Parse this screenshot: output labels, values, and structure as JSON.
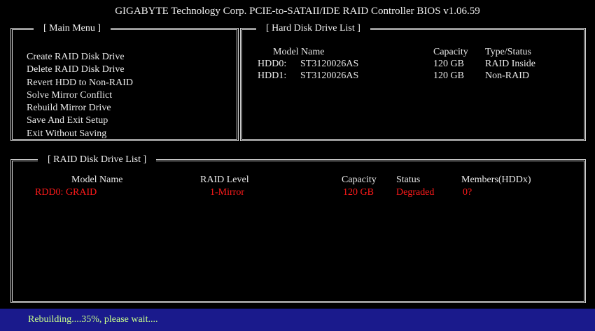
{
  "title": "GIGABYTE Technology Corp. PCIE-to-SATAII/IDE RAID Controller BIOS v1.06.59",
  "main_menu": {
    "heading": "[ Main Menu ]",
    "items": [
      "Create RAID Disk Drive",
      "Delete RAID Disk Drive",
      "Revert HDD to Non-RAID",
      "Solve Mirror Conflict",
      "Rebuild Mirror Drive",
      "Save And Exit Setup",
      "Exit Without Saving"
    ]
  },
  "hdd_list": {
    "heading": "[ Hard Disk Drive List ]",
    "col_model": "Model Name",
    "col_capacity": "Capacity",
    "col_type": "Type/Status",
    "rows": [
      {
        "id": "HDD0:",
        "model": "ST3120026AS",
        "capacity": "120 GB",
        "type": "RAID Inside"
      },
      {
        "id": "HDD1:",
        "model": "ST3120026AS",
        "capacity": "120 GB",
        "type": "Non-RAID"
      }
    ]
  },
  "raid_list": {
    "heading": "[ RAID Disk Drive List ]",
    "col_model": "Model Name",
    "col_level": "RAID Level",
    "col_capacity": "Capacity",
    "col_status": "Status",
    "col_members": "Members(HDDx)",
    "rows": [
      {
        "name": "RDD0: GRAID",
        "level": "1-Mirror",
        "capacity": "120 GB",
        "status": "Degraded",
        "members": "0?"
      }
    ]
  },
  "status_bar": {
    "text": "Rebuilding....35%, please wait....",
    "progress_percent": 35
  },
  "colors": {
    "background": "#000000",
    "border": "#d8d8d8",
    "highlight_row": "#ff1a1a",
    "status_bar_bg": "#1a1a8c",
    "status_text": "#c8ff8c"
  }
}
